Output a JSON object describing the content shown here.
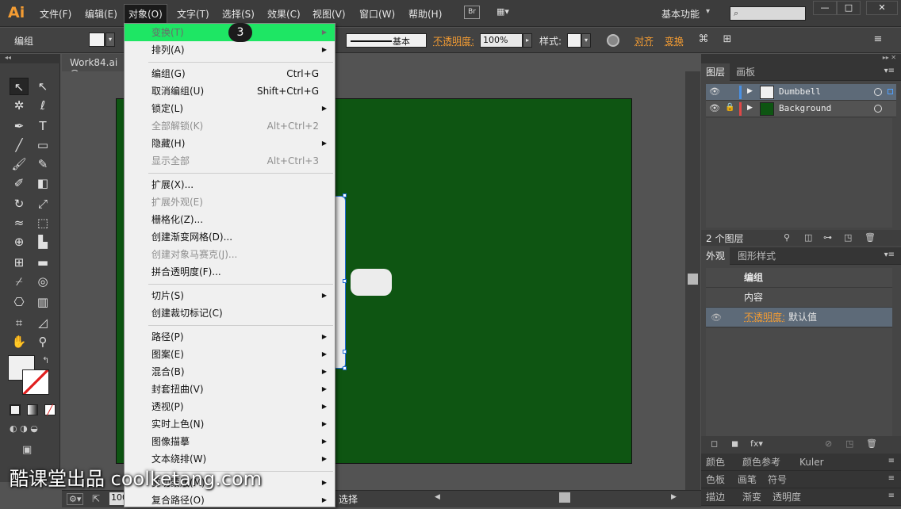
{
  "app": {
    "logo": "Ai",
    "brand_color": "#f39c33"
  },
  "menubar": {
    "items": [
      "文件(F)",
      "编辑(E)",
      "对象(O)",
      "文字(T)",
      "选择(S)",
      "效果(C)",
      "视图(V)",
      "窗口(W)",
      "帮助(H)"
    ],
    "active_index": 2,
    "bridge": "Br",
    "workspace": "基本功能",
    "window_buttons": [
      "—",
      "□",
      "✕"
    ]
  },
  "controlbar": {
    "group_label": "编组",
    "stroke_label": "基本",
    "opacity_label": "不透明度:",
    "opacity_value": "100%",
    "style_label": "样式:",
    "align_link": "对齐",
    "transform_link": "变换"
  },
  "document": {
    "tab": "Work84.ai @",
    "zoom": "100",
    "status": "选择",
    "artboard_color": "#0e5512"
  },
  "context_menu": {
    "items": [
      {
        "label": "变换(T)",
        "shortcut": "",
        "submenu": true,
        "disabled": false,
        "highlight": true
      },
      {
        "label": "排列(A)",
        "shortcut": "",
        "submenu": true,
        "disabled": false
      },
      {
        "label": "编组(G)",
        "shortcut": "Ctrl+G",
        "submenu": false,
        "disabled": false
      },
      {
        "label": "取消编组(U)",
        "shortcut": "Shift+Ctrl+G",
        "submenu": false,
        "disabled": false
      },
      {
        "label": "锁定(L)",
        "shortcut": "",
        "submenu": true,
        "disabled": false
      },
      {
        "label": "全部解锁(K)",
        "shortcut": "Alt+Ctrl+2",
        "submenu": false,
        "disabled": true
      },
      {
        "label": "隐藏(H)",
        "shortcut": "",
        "submenu": true,
        "disabled": false
      },
      {
        "label": "显示全部",
        "shortcut": "Alt+Ctrl+3",
        "submenu": false,
        "disabled": true
      },
      {
        "label": "扩展(X)...",
        "shortcut": "",
        "submenu": false,
        "disabled": false
      },
      {
        "label": "扩展外观(E)",
        "shortcut": "",
        "submenu": false,
        "disabled": true
      },
      {
        "label": "栅格化(Z)...",
        "shortcut": "",
        "submenu": false,
        "disabled": false
      },
      {
        "label": "创建渐变网格(D)...",
        "shortcut": "",
        "submenu": false,
        "disabled": false
      },
      {
        "label": "创建对象马赛克(J)...",
        "shortcut": "",
        "submenu": false,
        "disabled": true
      },
      {
        "label": "拼合透明度(F)...",
        "shortcut": "",
        "submenu": false,
        "disabled": false
      },
      {
        "label": "切片(S)",
        "shortcut": "",
        "submenu": true,
        "disabled": false
      },
      {
        "label": "创建裁切标记(C)",
        "shortcut": "",
        "submenu": false,
        "disabled": false
      },
      {
        "label": "路径(P)",
        "shortcut": "",
        "submenu": true,
        "disabled": false
      },
      {
        "label": "图案(E)",
        "shortcut": "",
        "submenu": true,
        "disabled": false
      },
      {
        "label": "混合(B)",
        "shortcut": "",
        "submenu": true,
        "disabled": false
      },
      {
        "label": "封套扭曲(V)",
        "shortcut": "",
        "submenu": true,
        "disabled": false
      },
      {
        "label": "透视(P)",
        "shortcut": "",
        "submenu": true,
        "disabled": false
      },
      {
        "label": "实时上色(N)",
        "shortcut": "",
        "submenu": true,
        "disabled": false
      },
      {
        "label": "图像描摹",
        "shortcut": "",
        "submenu": true,
        "disabled": false
      },
      {
        "label": "文本绕排(W)",
        "shortcut": "",
        "submenu": true,
        "disabled": false
      },
      {
        "label": "剪切蒙版(M)",
        "shortcut": "",
        "submenu": true,
        "disabled": false
      },
      {
        "label": "复合路径(O)",
        "shortcut": "",
        "submenu": true,
        "disabled": false
      }
    ],
    "step_badge": "3",
    "highlight_color": "#1ee664"
  },
  "layers_panel": {
    "tabs": [
      "图层",
      "画板"
    ],
    "layers": [
      {
        "name": "Dumbbell",
        "color": "#4a90e2",
        "selected": true
      },
      {
        "name": "Background",
        "color": "#e04848",
        "selected": false
      }
    ],
    "count_text": "2 个图层"
  },
  "appearance_panel": {
    "tabs": [
      "外观",
      "图形样式"
    ],
    "title": "编组",
    "content_label": "内容",
    "opacity_label": "不透明度:",
    "opacity_value": "默认值"
  },
  "bottom_tabs": {
    "row1": [
      "颜色",
      "颜色参考",
      "Kuler"
    ],
    "row2": [
      "色板",
      "画笔",
      "符号"
    ],
    "row3": [
      "描边",
      "渐变",
      "透明度"
    ]
  },
  "watermark": "酷课堂出品 coolketang.com"
}
